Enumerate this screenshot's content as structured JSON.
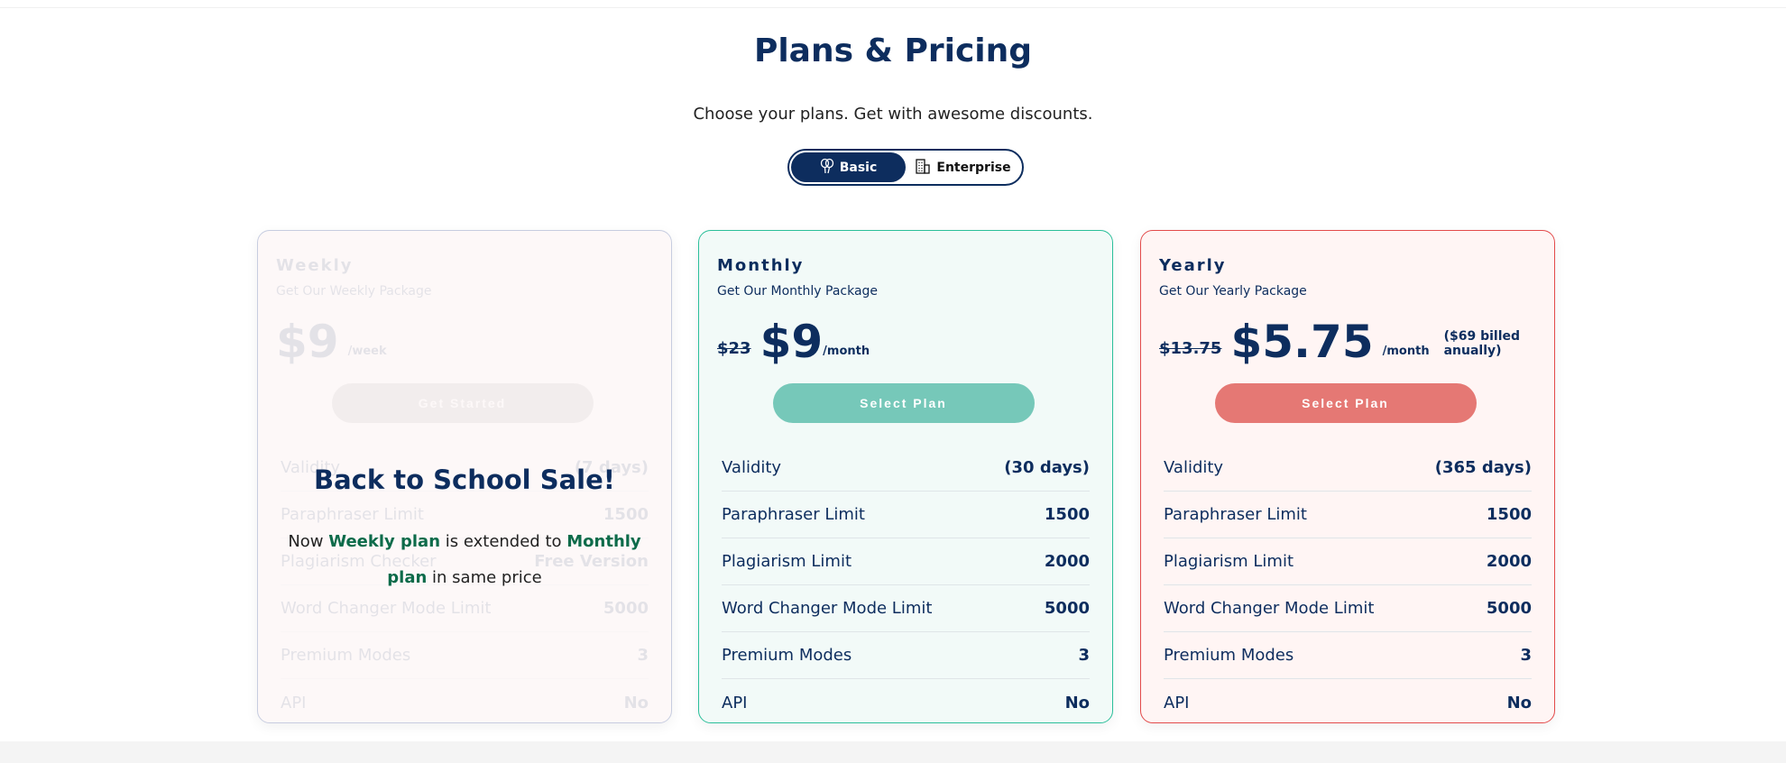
{
  "header": {
    "title": "Plans & Pricing",
    "subtitle": "Choose your plans. Get with awesome discounts."
  },
  "toggle": {
    "options": [
      {
        "label": "Basic",
        "icon": "balloons-icon",
        "active": true
      },
      {
        "label": "Enterprise",
        "icon": "building-icon",
        "active": false
      }
    ]
  },
  "colors": {
    "navy": "#0d2d5e",
    "teal": "#76c8b9",
    "teal_border": "#2bbf9a",
    "red": "#e57874",
    "red_border": "#e34b4b",
    "green": "#0c6b4a"
  },
  "plans": [
    {
      "name": "Weekly",
      "desc": "Get Our Weekly Package",
      "old_price": "",
      "price": "$9",
      "period": "/week",
      "note": "",
      "button": "Get Started",
      "rows": [
        {
          "label": "Validity",
          "value": "(7 days)"
        },
        {
          "label": "Paraphraser Limit",
          "value": "1500"
        },
        {
          "label": "Plagiarism Checker",
          "value": "Free Version"
        },
        {
          "label": "Word Changer Mode Limit",
          "value": "5000"
        },
        {
          "label": "Premium Modes",
          "value": "3"
        },
        {
          "label": "API",
          "value": "No"
        }
      ]
    },
    {
      "name": "Monthly",
      "desc": "Get Our Monthly Package",
      "old_price": "$23",
      "price": "$9",
      "period": "/month",
      "note": "",
      "button": "Select Plan",
      "rows": [
        {
          "label": "Validity",
          "value": "(30 days)"
        },
        {
          "label": "Paraphraser Limit",
          "value": "1500"
        },
        {
          "label": "Plagiarism Limit",
          "value": "2000"
        },
        {
          "label": "Word Changer Mode Limit",
          "value": "5000"
        },
        {
          "label": "Premium Modes",
          "value": "3"
        },
        {
          "label": "API",
          "value": "No"
        }
      ]
    },
    {
      "name": "Yearly",
      "desc": "Get Our Yearly Package",
      "old_price": "$13.75",
      "price": "$5.75",
      "period": "/month",
      "note": "($69 billed anually)",
      "button": "Select Plan",
      "rows": [
        {
          "label": "Validity",
          "value": "(365 days)"
        },
        {
          "label": "Paraphraser Limit",
          "value": "1500"
        },
        {
          "label": "Plagiarism Limit",
          "value": "2000"
        },
        {
          "label": "Word Changer Mode Limit",
          "value": "5000"
        },
        {
          "label": "Premium Modes",
          "value": "3"
        },
        {
          "label": "API",
          "value": "No"
        }
      ]
    }
  ],
  "sale": {
    "title": "Back to School Sale!",
    "pre": "Now ",
    "hl1": "Weekly plan",
    "mid": " is extended to ",
    "hl2": "Monthly plan",
    "post": " in same price"
  }
}
